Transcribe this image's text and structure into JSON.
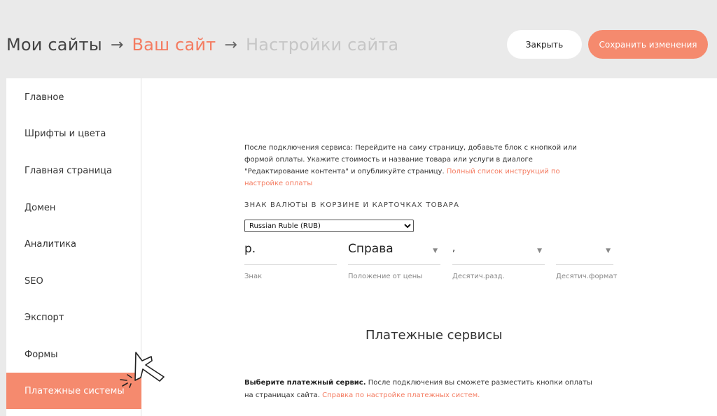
{
  "header": {
    "breadcrumb": {
      "item1": "Мои сайты",
      "arrow": "→",
      "item2": "Ваш сайт",
      "item3": "Настройки сайта"
    },
    "close_label": "Закрыть",
    "save_label": "Сохранить изменения"
  },
  "sidebar": {
    "items": [
      {
        "label": "Главное"
      },
      {
        "label": "Шрифты и цвета"
      },
      {
        "label": "Главная страница"
      },
      {
        "label": "Домен"
      },
      {
        "label": "Аналитика"
      },
      {
        "label": "SEO"
      },
      {
        "label": "Экспорт"
      },
      {
        "label": "Формы"
      },
      {
        "label": "Платежные системы",
        "active": true
      }
    ]
  },
  "main": {
    "info_text": "После подключения сервиса: Перейдите на саму страницу, добавьте блок с кнопкой или формой оплаты. Укажите стоимость и название товара или услуги в диалоге \"Редактирование контента\" и опубликуйте страницу.",
    "info_link": "Полный список инструкций по настройке оплаты",
    "currency_title": "ЗНАК ВАЛЮТЫ В КОРЗИНЕ И КАРТОЧКАХ ТОВАРА",
    "currency_select": "Russian Ruble (RUB)",
    "fields": {
      "sign": {
        "value": "р.",
        "label": "Знак"
      },
      "position": {
        "value": "Справа",
        "label": "Положение от цены"
      },
      "decimal_sep": {
        "value": ",",
        "label": "Десятич.разд."
      },
      "decimal_format": {
        "value": "",
        "label": "Десятич.формат"
      }
    },
    "payment_title": "Платежные сервисы",
    "payment_bold": "Выберите платежный сервис.",
    "payment_text": "После подключения вы сможете разместить кнопки оплаты на страницах сайта.",
    "payment_link": "Справка по настройке платежных систем."
  },
  "colors": {
    "accent": "#f58a6e",
    "header_bg": "#eaeaea"
  }
}
